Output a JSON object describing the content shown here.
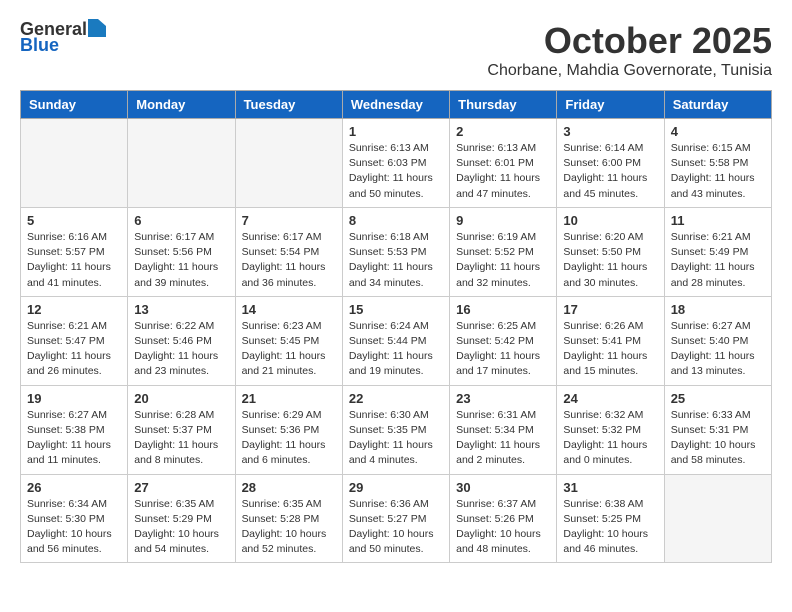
{
  "logo": {
    "general": "General",
    "blue": "Blue"
  },
  "title": "October 2025",
  "subtitle": "Chorbane, Mahdia Governorate, Tunisia",
  "weekdays": [
    "Sunday",
    "Monday",
    "Tuesday",
    "Wednesday",
    "Thursday",
    "Friday",
    "Saturday"
  ],
  "weeks": [
    [
      {
        "day": "",
        "info": ""
      },
      {
        "day": "",
        "info": ""
      },
      {
        "day": "",
        "info": ""
      },
      {
        "day": "1",
        "info": "Sunrise: 6:13 AM\nSunset: 6:03 PM\nDaylight: 11 hours\nand 50 minutes."
      },
      {
        "day": "2",
        "info": "Sunrise: 6:13 AM\nSunset: 6:01 PM\nDaylight: 11 hours\nand 47 minutes."
      },
      {
        "day": "3",
        "info": "Sunrise: 6:14 AM\nSunset: 6:00 PM\nDaylight: 11 hours\nand 45 minutes."
      },
      {
        "day": "4",
        "info": "Sunrise: 6:15 AM\nSunset: 5:58 PM\nDaylight: 11 hours\nand 43 minutes."
      }
    ],
    [
      {
        "day": "5",
        "info": "Sunrise: 6:16 AM\nSunset: 5:57 PM\nDaylight: 11 hours\nand 41 minutes."
      },
      {
        "day": "6",
        "info": "Sunrise: 6:17 AM\nSunset: 5:56 PM\nDaylight: 11 hours\nand 39 minutes."
      },
      {
        "day": "7",
        "info": "Sunrise: 6:17 AM\nSunset: 5:54 PM\nDaylight: 11 hours\nand 36 minutes."
      },
      {
        "day": "8",
        "info": "Sunrise: 6:18 AM\nSunset: 5:53 PM\nDaylight: 11 hours\nand 34 minutes."
      },
      {
        "day": "9",
        "info": "Sunrise: 6:19 AM\nSunset: 5:52 PM\nDaylight: 11 hours\nand 32 minutes."
      },
      {
        "day": "10",
        "info": "Sunrise: 6:20 AM\nSunset: 5:50 PM\nDaylight: 11 hours\nand 30 minutes."
      },
      {
        "day": "11",
        "info": "Sunrise: 6:21 AM\nSunset: 5:49 PM\nDaylight: 11 hours\nand 28 minutes."
      }
    ],
    [
      {
        "day": "12",
        "info": "Sunrise: 6:21 AM\nSunset: 5:47 PM\nDaylight: 11 hours\nand 26 minutes."
      },
      {
        "day": "13",
        "info": "Sunrise: 6:22 AM\nSunset: 5:46 PM\nDaylight: 11 hours\nand 23 minutes."
      },
      {
        "day": "14",
        "info": "Sunrise: 6:23 AM\nSunset: 5:45 PM\nDaylight: 11 hours\nand 21 minutes."
      },
      {
        "day": "15",
        "info": "Sunrise: 6:24 AM\nSunset: 5:44 PM\nDaylight: 11 hours\nand 19 minutes."
      },
      {
        "day": "16",
        "info": "Sunrise: 6:25 AM\nSunset: 5:42 PM\nDaylight: 11 hours\nand 17 minutes."
      },
      {
        "day": "17",
        "info": "Sunrise: 6:26 AM\nSunset: 5:41 PM\nDaylight: 11 hours\nand 15 minutes."
      },
      {
        "day": "18",
        "info": "Sunrise: 6:27 AM\nSunset: 5:40 PM\nDaylight: 11 hours\nand 13 minutes."
      }
    ],
    [
      {
        "day": "19",
        "info": "Sunrise: 6:27 AM\nSunset: 5:38 PM\nDaylight: 11 hours\nand 11 minutes."
      },
      {
        "day": "20",
        "info": "Sunrise: 6:28 AM\nSunset: 5:37 PM\nDaylight: 11 hours\nand 8 minutes."
      },
      {
        "day": "21",
        "info": "Sunrise: 6:29 AM\nSunset: 5:36 PM\nDaylight: 11 hours\nand 6 minutes."
      },
      {
        "day": "22",
        "info": "Sunrise: 6:30 AM\nSunset: 5:35 PM\nDaylight: 11 hours\nand 4 minutes."
      },
      {
        "day": "23",
        "info": "Sunrise: 6:31 AM\nSunset: 5:34 PM\nDaylight: 11 hours\nand 2 minutes."
      },
      {
        "day": "24",
        "info": "Sunrise: 6:32 AM\nSunset: 5:32 PM\nDaylight: 11 hours\nand 0 minutes."
      },
      {
        "day": "25",
        "info": "Sunrise: 6:33 AM\nSunset: 5:31 PM\nDaylight: 10 hours\nand 58 minutes."
      }
    ],
    [
      {
        "day": "26",
        "info": "Sunrise: 6:34 AM\nSunset: 5:30 PM\nDaylight: 10 hours\nand 56 minutes."
      },
      {
        "day": "27",
        "info": "Sunrise: 6:35 AM\nSunset: 5:29 PM\nDaylight: 10 hours\nand 54 minutes."
      },
      {
        "day": "28",
        "info": "Sunrise: 6:35 AM\nSunset: 5:28 PM\nDaylight: 10 hours\nand 52 minutes."
      },
      {
        "day": "29",
        "info": "Sunrise: 6:36 AM\nSunset: 5:27 PM\nDaylight: 10 hours\nand 50 minutes."
      },
      {
        "day": "30",
        "info": "Sunrise: 6:37 AM\nSunset: 5:26 PM\nDaylight: 10 hours\nand 48 minutes."
      },
      {
        "day": "31",
        "info": "Sunrise: 6:38 AM\nSunset: 5:25 PM\nDaylight: 10 hours\nand 46 minutes."
      },
      {
        "day": "",
        "info": ""
      }
    ]
  ]
}
